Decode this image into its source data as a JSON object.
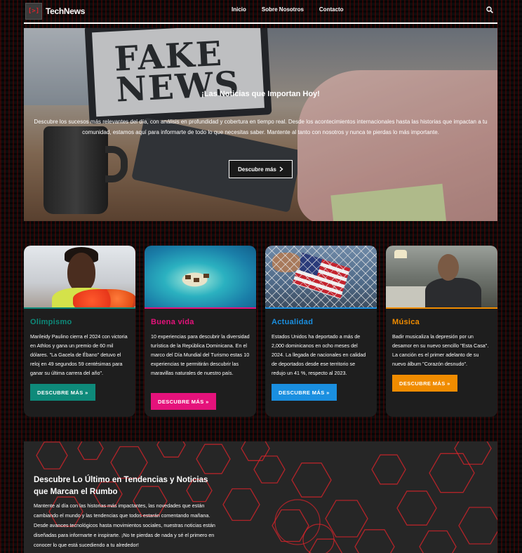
{
  "nav": {
    "logo_mark": "[>]",
    "brand": "TechNews",
    "links": [
      "Inicio",
      "Sobre Nosotros",
      "Contacto"
    ],
    "search_icon": "search-icon"
  },
  "hero": {
    "image_text": "FAKE NEWS",
    "title": "¡Las Noticias que Importan Hoy!",
    "description": "Descubre los sucesos más relevantes del día, con análisis en profundidad y cobertura en tiempo real. Desde los acontecimientos internacionales hasta las historias que impactan a tu comunidad, estamos aquí para informarte de todo lo que necesitas saber. Mantente al tanto con nosotros y nunca te pierdas lo más importante.",
    "button_label": "Descubre más",
    "button_icon": "chevron-right-icon"
  },
  "cards": [
    {
      "category": "Olimpismo",
      "color": "#0e8a7a",
      "text": "Marileidy Paulino cierra el 2024 con victoria en Athlos y gana un premio de 60 mil dólares. \"La Gacela de Ébano\" detuvo el reloj en 49 segundos 59 centésimas para ganar su última carrera del año\".",
      "button_label": "DESCUBRE MÁS »"
    },
    {
      "category": "Buena vida",
      "color": "#e5127b",
      "text": "10 experiencias para descubrir la diversidad turística de la República Dominicana. En el marco del Día Mundial del Turismo estas 10 experiencias te permitirán descubrir las maravillas naturales de nuestro país.",
      "button_label": "DESCUBRE MÁS »"
    },
    {
      "category": "Actualidad",
      "color": "#1a8fe0",
      "text": "Estados Unidos ha deportado a más de 2,000 dominicanos en ocho meses del 2024. La llegada de nacionales en calidad de deportados desde ese territorio se redujo un 41 %, respecto al 2023.",
      "button_label": "DESCUBRE MÁS »"
    },
    {
      "category": "Música",
      "color": "#f08c00",
      "text": "Badir musicaliza la depresión por un desamor en su nuevo sencillo \"Esta Casa\". La canción es el primer adelanto de su nuevo álbum \"Corazón desnudo\".",
      "button_label": "DESCUBRE MÁS »"
    }
  ],
  "bottom": {
    "title": "Descubre Lo Último en Tendencias y Noticias que Marcan el Rumbo",
    "text": "Mantente al día con las historias más impactantes, las novedades que están cambiando el mundo y las tendencias que todos estarán comentando mañana. Desde avances tecnológicos hasta movimientos sociales, nuestras noticias están diseñadas para informarte e inspirarte. ¡No te pierdas de nada y sé el primero en conocer lo que está sucediendo a tu alrededor!",
    "accent": "#e0242b"
  }
}
